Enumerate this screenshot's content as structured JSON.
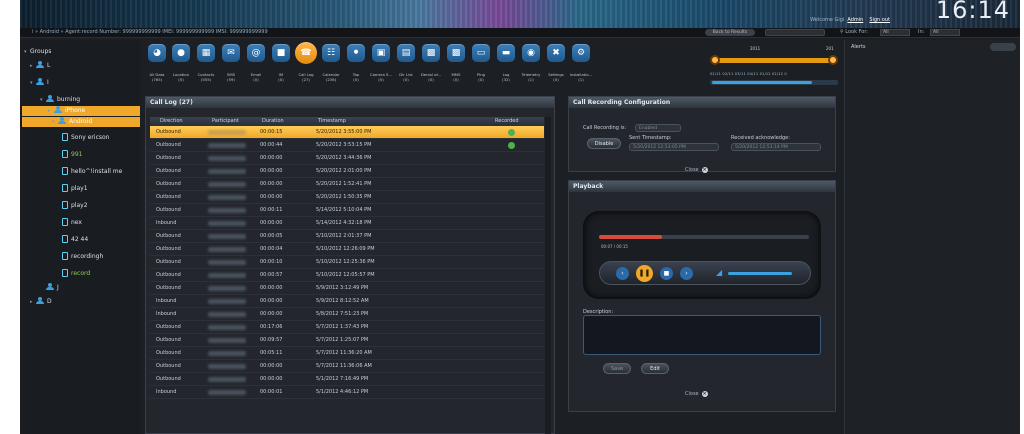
{
  "header": {
    "clock": "16:14",
    "welcome": "Welcome Gigi",
    "admin_link": "Admin",
    "signout_link": "Sign out"
  },
  "infobar": {
    "path": "i » Android » Agent:record  Number: 999999999999   IMEI: 999999999999   IMSI: 999999999999",
    "back_label": "Back to Results",
    "look_for": "Look For:",
    "scope_all": "All",
    "in_label": "In:",
    "in_all": "All"
  },
  "tree": {
    "groups": "Groups",
    "items": [
      {
        "label": "L"
      },
      {
        "label": "I"
      },
      {
        "label": "burning"
      },
      {
        "label": "iPhone"
      },
      {
        "label": "Android"
      },
      {
        "label": "Sony ericson"
      },
      {
        "label": "991"
      },
      {
        "label": "hello^!install me"
      },
      {
        "label": "play1"
      },
      {
        "label": "play2"
      },
      {
        "label": "nex"
      },
      {
        "label": "42 44"
      },
      {
        "label": "recordingh"
      },
      {
        "label": "record"
      },
      {
        "label": "J"
      },
      {
        "label": "D"
      }
    ]
  },
  "toolbar": {
    "buttons": [
      {
        "label": "All Data",
        "count": "(765)",
        "icon": "globe-icon"
      },
      {
        "label": "Location",
        "count": "(0)",
        "icon": "location-pin-icon"
      },
      {
        "label": "Contacts",
        "count": "(555)",
        "icon": "contacts-icon"
      },
      {
        "label": "SMS",
        "count": "(59)",
        "icon": "envelope-icon"
      },
      {
        "label": "Email",
        "count": "(0)",
        "icon": "at-icon"
      },
      {
        "label": "IM",
        "count": "(0)",
        "icon": "chat-icon"
      },
      {
        "label": "Call Log",
        "count": "(27)",
        "icon": "phone-icon"
      },
      {
        "label": "Calendar",
        "count": "(236)",
        "icon": "calendar-icon"
      },
      {
        "label": "Tap",
        "count": "(0)",
        "icon": "microphone-icon"
      },
      {
        "label": "Camera S...",
        "count": "(0)",
        "icon": "camera-icon"
      },
      {
        "label": "Dir List",
        "count": "(0)",
        "icon": "folder-icon"
      },
      {
        "label": "Denial of...",
        "count": "(0)",
        "icon": "lock-icon"
      },
      {
        "label": "MMS",
        "count": "(0)",
        "icon": "mms-icon"
      },
      {
        "label": "Ping",
        "count": "(0)",
        "icon": "monitor-icon"
      },
      {
        "label": "Log",
        "count": "(32)",
        "icon": "log-icon"
      },
      {
        "label": "Telemetry",
        "count": "(1)",
        "icon": "telemetry-icon"
      },
      {
        "label": "Settings",
        "count": "(0)",
        "icon": "tools-icon"
      },
      {
        "label": "Installatio...",
        "count": "(1)",
        "icon": "gear-icon"
      }
    ],
    "timeline": {
      "year_left": "2011",
      "year_right": "201",
      "dates": "02/11  02/11  03/11  04/11  01/12  02/12  0"
    }
  },
  "calllog": {
    "title": "Call Log (27)",
    "columns": [
      "Direction",
      "Participant",
      "Duration",
      "Timestamp",
      "Recorded"
    ],
    "rows": [
      {
        "direction": "Outbound",
        "duration": "00:00:15",
        "timestamp": "5/20/2012 3:55:00 PM",
        "recorded": true
      },
      {
        "direction": "Outbound",
        "duration": "00:00:44",
        "timestamp": "5/20/2012 3:53:15 PM",
        "recorded": true
      },
      {
        "direction": "Outbound",
        "duration": "00:00:00",
        "timestamp": "5/20/2012 3:44:36 PM",
        "recorded": false
      },
      {
        "direction": "Outbound",
        "duration": "00:00:00",
        "timestamp": "5/20/2012 2:01:00 PM",
        "recorded": false
      },
      {
        "direction": "Outbound",
        "duration": "00:00:00",
        "timestamp": "5/20/2012 1:52:41 PM",
        "recorded": false
      },
      {
        "direction": "Outbound",
        "duration": "00:00:00",
        "timestamp": "5/20/2012 1:50:35 PM",
        "recorded": false
      },
      {
        "direction": "Outbound",
        "duration": "00:00:11",
        "timestamp": "5/14/2012 5:10:04 PM",
        "recorded": false
      },
      {
        "direction": "Inbound",
        "duration": "00:00:00",
        "timestamp": "5/14/2012 4:32:18 PM",
        "recorded": false
      },
      {
        "direction": "Outbound",
        "duration": "00:00:05",
        "timestamp": "5/10/2012 2:01:37 PM",
        "recorded": false
      },
      {
        "direction": "Outbound",
        "duration": "00:00:04",
        "timestamp": "5/10/2012 12:26:09 PM",
        "recorded": false
      },
      {
        "direction": "Outbound",
        "duration": "00:00:10",
        "timestamp": "5/10/2012 12:25:36 PM",
        "recorded": false
      },
      {
        "direction": "Outbound",
        "duration": "00:00:57",
        "timestamp": "5/10/2012 12:05:57 PM",
        "recorded": false
      },
      {
        "direction": "Outbound",
        "duration": "00:00:00",
        "timestamp": "5/9/2012 3:12:49 PM",
        "recorded": false
      },
      {
        "direction": "Inbound",
        "duration": "00:00:00",
        "timestamp": "5/9/2012 8:12:52 AM",
        "recorded": false
      },
      {
        "direction": "Inbound",
        "duration": "00:00:00",
        "timestamp": "5/8/2012 7:51:23 PM",
        "recorded": false
      },
      {
        "direction": "Outbound",
        "duration": "00:17:06",
        "timestamp": "5/7/2012 1:37:43 PM",
        "recorded": false
      },
      {
        "direction": "Outbound",
        "duration": "00:09:57",
        "timestamp": "5/7/2012 1:25:07 PM",
        "recorded": false
      },
      {
        "direction": "Outbound",
        "duration": "00:05:11",
        "timestamp": "5/7/2012 11:36:20 AM",
        "recorded": false
      },
      {
        "direction": "Outbound",
        "duration": "00:00:00",
        "timestamp": "5/7/2012 11:36:06 AM",
        "recorded": false
      },
      {
        "direction": "Outbound",
        "duration": "00:00:00",
        "timestamp": "5/1/2012 7:16:49 PM",
        "recorded": false
      },
      {
        "direction": "Inbound",
        "duration": "00:00:01",
        "timestamp": "5/1/2012 4:46:12 PM",
        "recorded": false
      }
    ]
  },
  "config": {
    "title": "Call Recording Configuration",
    "recording_label": "Call Recording is:",
    "recording_value": "Enabled",
    "disable_button": "Disable",
    "sent_label": "Sent Timestamp:",
    "sent_value": "5/20/2012 12:53:05 PM",
    "received_label": "Received acknowledge:",
    "received_value": "5/20/2012 12:53:14 PM",
    "close_label": "Close"
  },
  "playback": {
    "title": "Playback",
    "progress": 0.3,
    "time": "00:07 / 00:15",
    "description_label": "Description:",
    "save_button": "Save",
    "edit_button": "Edit",
    "close_label": "Close"
  },
  "alerts": {
    "title": "Alerts"
  }
}
